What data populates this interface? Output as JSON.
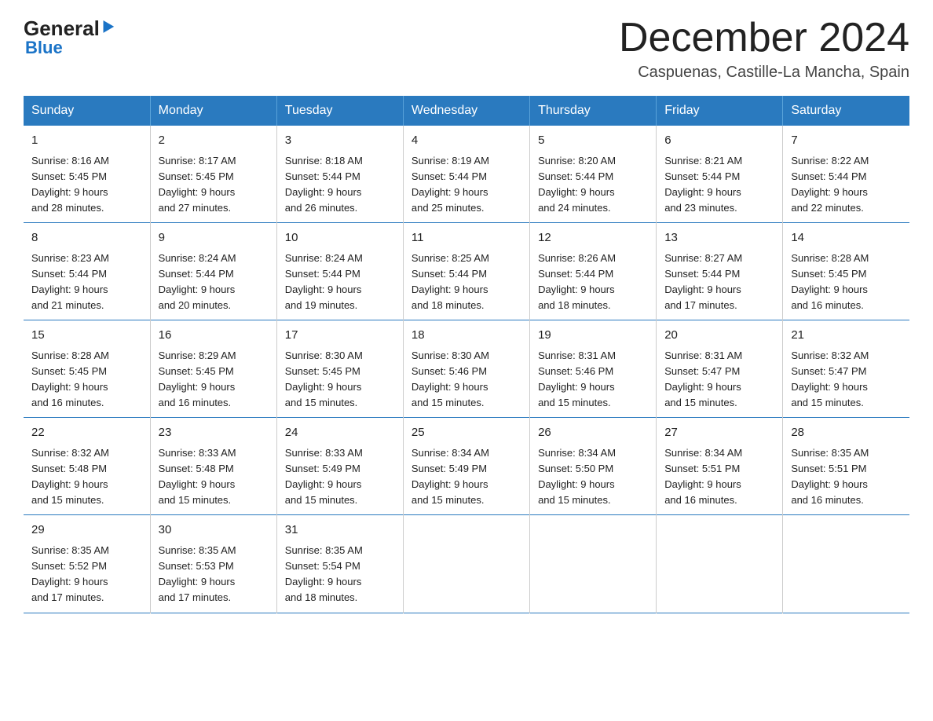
{
  "logo": {
    "general": "General",
    "blue": "Blue"
  },
  "title": "December 2024",
  "subtitle": "Caspuenas, Castille-La Mancha, Spain",
  "days_of_week": [
    "Sunday",
    "Monday",
    "Tuesday",
    "Wednesday",
    "Thursday",
    "Friday",
    "Saturday"
  ],
  "weeks": [
    [
      {
        "day": "1",
        "sunrise": "8:16 AM",
        "sunset": "5:45 PM",
        "daylight": "9 hours and 28 minutes."
      },
      {
        "day": "2",
        "sunrise": "8:17 AM",
        "sunset": "5:45 PM",
        "daylight": "9 hours and 27 minutes."
      },
      {
        "day": "3",
        "sunrise": "8:18 AM",
        "sunset": "5:44 PM",
        "daylight": "9 hours and 26 minutes."
      },
      {
        "day": "4",
        "sunrise": "8:19 AM",
        "sunset": "5:44 PM",
        "daylight": "9 hours and 25 minutes."
      },
      {
        "day": "5",
        "sunrise": "8:20 AM",
        "sunset": "5:44 PM",
        "daylight": "9 hours and 24 minutes."
      },
      {
        "day": "6",
        "sunrise": "8:21 AM",
        "sunset": "5:44 PM",
        "daylight": "9 hours and 23 minutes."
      },
      {
        "day": "7",
        "sunrise": "8:22 AM",
        "sunset": "5:44 PM",
        "daylight": "9 hours and 22 minutes."
      }
    ],
    [
      {
        "day": "8",
        "sunrise": "8:23 AM",
        "sunset": "5:44 PM",
        "daylight": "9 hours and 21 minutes."
      },
      {
        "day": "9",
        "sunrise": "8:24 AM",
        "sunset": "5:44 PM",
        "daylight": "9 hours and 20 minutes."
      },
      {
        "day": "10",
        "sunrise": "8:24 AM",
        "sunset": "5:44 PM",
        "daylight": "9 hours and 19 minutes."
      },
      {
        "day": "11",
        "sunrise": "8:25 AM",
        "sunset": "5:44 PM",
        "daylight": "9 hours and 18 minutes."
      },
      {
        "day": "12",
        "sunrise": "8:26 AM",
        "sunset": "5:44 PM",
        "daylight": "9 hours and 18 minutes."
      },
      {
        "day": "13",
        "sunrise": "8:27 AM",
        "sunset": "5:44 PM",
        "daylight": "9 hours and 17 minutes."
      },
      {
        "day": "14",
        "sunrise": "8:28 AM",
        "sunset": "5:45 PM",
        "daylight": "9 hours and 16 minutes."
      }
    ],
    [
      {
        "day": "15",
        "sunrise": "8:28 AM",
        "sunset": "5:45 PM",
        "daylight": "9 hours and 16 minutes."
      },
      {
        "day": "16",
        "sunrise": "8:29 AM",
        "sunset": "5:45 PM",
        "daylight": "9 hours and 16 minutes."
      },
      {
        "day": "17",
        "sunrise": "8:30 AM",
        "sunset": "5:45 PM",
        "daylight": "9 hours and 15 minutes."
      },
      {
        "day": "18",
        "sunrise": "8:30 AM",
        "sunset": "5:46 PM",
        "daylight": "9 hours and 15 minutes."
      },
      {
        "day": "19",
        "sunrise": "8:31 AM",
        "sunset": "5:46 PM",
        "daylight": "9 hours and 15 minutes."
      },
      {
        "day": "20",
        "sunrise": "8:31 AM",
        "sunset": "5:47 PM",
        "daylight": "9 hours and 15 minutes."
      },
      {
        "day": "21",
        "sunrise": "8:32 AM",
        "sunset": "5:47 PM",
        "daylight": "9 hours and 15 minutes."
      }
    ],
    [
      {
        "day": "22",
        "sunrise": "8:32 AM",
        "sunset": "5:48 PM",
        "daylight": "9 hours and 15 minutes."
      },
      {
        "day": "23",
        "sunrise": "8:33 AM",
        "sunset": "5:48 PM",
        "daylight": "9 hours and 15 minutes."
      },
      {
        "day": "24",
        "sunrise": "8:33 AM",
        "sunset": "5:49 PM",
        "daylight": "9 hours and 15 minutes."
      },
      {
        "day": "25",
        "sunrise": "8:34 AM",
        "sunset": "5:49 PM",
        "daylight": "9 hours and 15 minutes."
      },
      {
        "day": "26",
        "sunrise": "8:34 AM",
        "sunset": "5:50 PM",
        "daylight": "9 hours and 15 minutes."
      },
      {
        "day": "27",
        "sunrise": "8:34 AM",
        "sunset": "5:51 PM",
        "daylight": "9 hours and 16 minutes."
      },
      {
        "day": "28",
        "sunrise": "8:35 AM",
        "sunset": "5:51 PM",
        "daylight": "9 hours and 16 minutes."
      }
    ],
    [
      {
        "day": "29",
        "sunrise": "8:35 AM",
        "sunset": "5:52 PM",
        "daylight": "9 hours and 17 minutes."
      },
      {
        "day": "30",
        "sunrise": "8:35 AM",
        "sunset": "5:53 PM",
        "daylight": "9 hours and 17 minutes."
      },
      {
        "day": "31",
        "sunrise": "8:35 AM",
        "sunset": "5:54 PM",
        "daylight": "9 hours and 18 minutes."
      },
      null,
      null,
      null,
      null
    ]
  ],
  "labels": {
    "sunrise": "Sunrise:",
    "sunset": "Sunset:",
    "daylight": "Daylight:"
  }
}
